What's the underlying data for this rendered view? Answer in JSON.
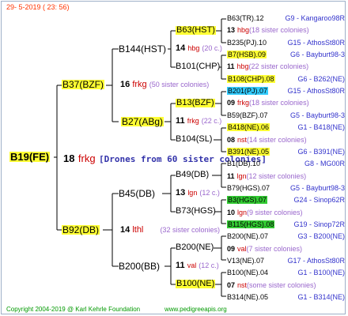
{
  "header": "29-  5-2019 ( 23: 56)",
  "footer_copyright": "Copyright 2004-2019 @ Karl Kehrle Foundation",
  "footer_site": "www.pedigreeapis.org",
  "root": {
    "label": "B19(FE)",
    "num": "18",
    "code": "frkg",
    "note": "Drones from 60 sister colonies"
  },
  "gen1": {
    "upper": {
      "label": "B37(BZF)"
    },
    "lower": {
      "label": "B92(DB)"
    }
  },
  "gen1_upper_info": {
    "num": "16",
    "code": "frkg",
    "sis": "(50 sister colonies)"
  },
  "gen1_lower_info": {
    "num": "14",
    "code": "lthl",
    "sis": "(32 sister colonies)"
  },
  "gen2": {
    "a": {
      "label": "B144(HST)"
    },
    "b": {
      "label": "B27(ABg)"
    },
    "c": {
      "label": "B45(DB)"
    },
    "d": {
      "label": "B200(BB)"
    }
  },
  "gen2_info": {
    "b": {
      "num": "11",
      "code": "frkg",
      "sis": "(22 c.)"
    }
  },
  "gen3": {
    "a1": {
      "label": "B63(HST)"
    },
    "a1i": {
      "num": "14",
      "code": "hbg",
      "sis": "(20 c.)"
    },
    "a2": {
      "label": "B101(CHP)"
    },
    "b1": {
      "label": "B13(BZF)"
    },
    "b2": {
      "label": "B104(SL)"
    },
    "c1": {
      "label": "B49(DB)"
    },
    "c1i": {
      "num": "13",
      "code": "lgn",
      "sis": "(12 c.)"
    },
    "c2": {
      "label": "B73(HGS)"
    },
    "d1": {
      "label": "B200(NE)"
    },
    "d1i": {
      "num": "11",
      "code": "val",
      "sis": "(12 c.)"
    },
    "d2": {
      "label": "B100(NE)"
    }
  },
  "gen4": [
    {
      "label": "B63(TR).12",
      "info": "G9 - Kangaroo98R"
    },
    {
      "num": "13",
      "code": "hbg",
      "sis": "(18 sister colonies)"
    },
    {
      "label": "B235(PJ).10",
      "info": "G15 - AthosSt80R"
    },
    {
      "label": "B7(HSB).09",
      "info": "G6 - Bayburt98-3"
    },
    {
      "num": "11",
      "code": "hbg",
      "sis": "(22 sister colonies)"
    },
    {
      "label": "B108(CHP).08",
      "info": "G6 - B262(NE)"
    },
    {
      "label": "B201(PJ).07",
      "info": "G15 - AthosSt80R"
    },
    {
      "num": "09",
      "code": "frkg",
      "sis": "(18 sister colonies)"
    },
    {
      "label": "B59(BZF).07",
      "info": "G5 - Bayburt98-3"
    },
    {
      "label": "B418(NE).06",
      "info": "G1 - B418(NE)"
    },
    {
      "num": "08",
      "code": "nst",
      "sis": "(14 sister colonies)"
    },
    {
      "label": "B391(NE).05",
      "info": "G6 - B391(NE)"
    },
    {
      "label": "B1(DB).10",
      "info": "G8 - MG00R"
    },
    {
      "num": "11",
      "code": "lgn",
      "sis": "(12 sister colonies)"
    },
    {
      "label": "B79(HGS).07",
      "info": "G5 - Bayburt98-3"
    },
    {
      "label": "B3(HGS).07",
      "info": "G24 - Sinop62R"
    },
    {
      "num": "10",
      "code": "lgn",
      "sis": "(9 sister colonies)"
    },
    {
      "label": "B115(HGS).08",
      "info": "G19 - Sinop72R"
    },
    {
      "label": "B200(NE).07",
      "info": "G3 - B200(NE)"
    },
    {
      "num": "09",
      "code": "val",
      "sis": "(7 sister colonies)"
    },
    {
      "label": "V13(NE).07",
      "info": "G17 - AthosSt80R"
    },
    {
      "label": "B100(NE).04",
      "info": "G1 - B100(NE)"
    },
    {
      "num": "07",
      "code": "nst",
      "sis": "(some sister colonies)"
    },
    {
      "label": "B314(NE).05",
      "info": "G1 - B314(NE)"
    }
  ],
  "colors": {
    "highlight": "#ffff33",
    "cyan": "#33ccff",
    "green": "#33cc33",
    "code": "#cc0000",
    "sister": "#9966cc",
    "info": "#3333cc"
  }
}
